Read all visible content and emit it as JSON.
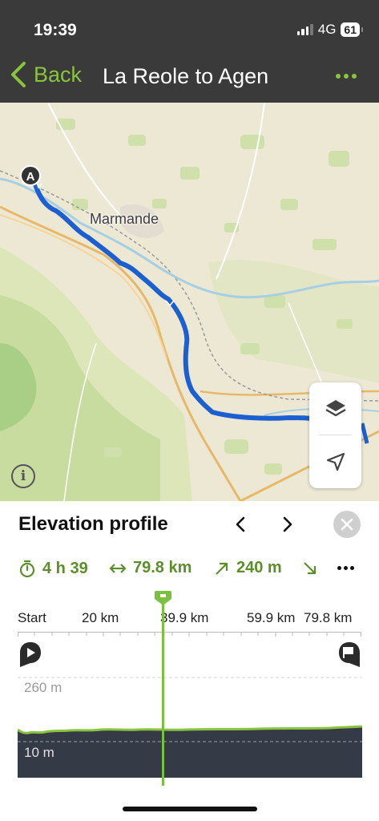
{
  "status_bar": {
    "time": "19:39",
    "network": "4G",
    "battery": "61"
  },
  "nav": {
    "back_label": "Back",
    "title": "La Reole to Agen"
  },
  "map": {
    "place_label": "Marmande",
    "marker_label": "A",
    "info_glyph": "i"
  },
  "panel": {
    "title": "Elevation profile",
    "stats": {
      "duration": "4 h 39",
      "distance": "79.8 km",
      "ascent": "240 m"
    },
    "scale_ticks": [
      "Start",
      "20 km",
      "39.9 km",
      "59.9 km",
      "79.8 km"
    ],
    "elevation_top_label": "260 m",
    "elevation_bottom_label": "10 m"
  },
  "colors": {
    "accent": "#8ac43f",
    "route": "#1b5fd1",
    "header": "#3a3a3a",
    "chart_fill": "#343a46"
  },
  "icons": {
    "back": "chevron-left-icon",
    "more": "more-dots-icon",
    "layers": "layers-icon",
    "locate": "locate-arrow-icon",
    "info": "info-icon",
    "prev": "chevron-left-icon",
    "next": "chevron-right-icon",
    "close": "close-icon",
    "duration": "stopwatch-icon",
    "distance": "horizontal-arrows-icon",
    "ascent": "arrow-up-right-icon",
    "descent": "arrow-down-right-icon",
    "start": "play-pin-icon",
    "finish": "flag-pin-icon"
  }
}
